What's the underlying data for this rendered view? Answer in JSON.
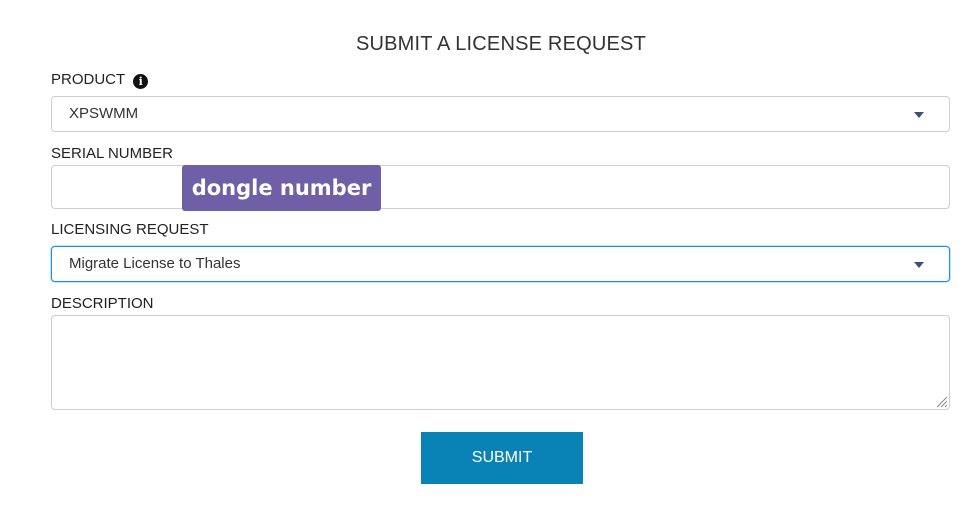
{
  "form": {
    "title": "SUBMIT A LICENSE REQUEST",
    "product": {
      "label": "PRODUCT",
      "info_icon": "info-icon",
      "selected_value": "XPSWMM"
    },
    "serial_number": {
      "label": "SERIAL NUMBER",
      "value": ""
    },
    "licensing_request": {
      "label": "LICENSING REQUEST",
      "selected_value": "Migrate License to Thales"
    },
    "description": {
      "label": "DESCRIPTION",
      "value": ""
    },
    "submit_label": "SUBMIT"
  },
  "annotation": {
    "text": "dongle number",
    "color": "#6f5fa6"
  },
  "colors": {
    "accent": "#0983b5",
    "focus_border": "#1a8fe8",
    "caret": "#3e4f7a"
  },
  "icons": [
    "info-icon",
    "chevron-down-icon",
    "resize-grip-icon"
  ]
}
